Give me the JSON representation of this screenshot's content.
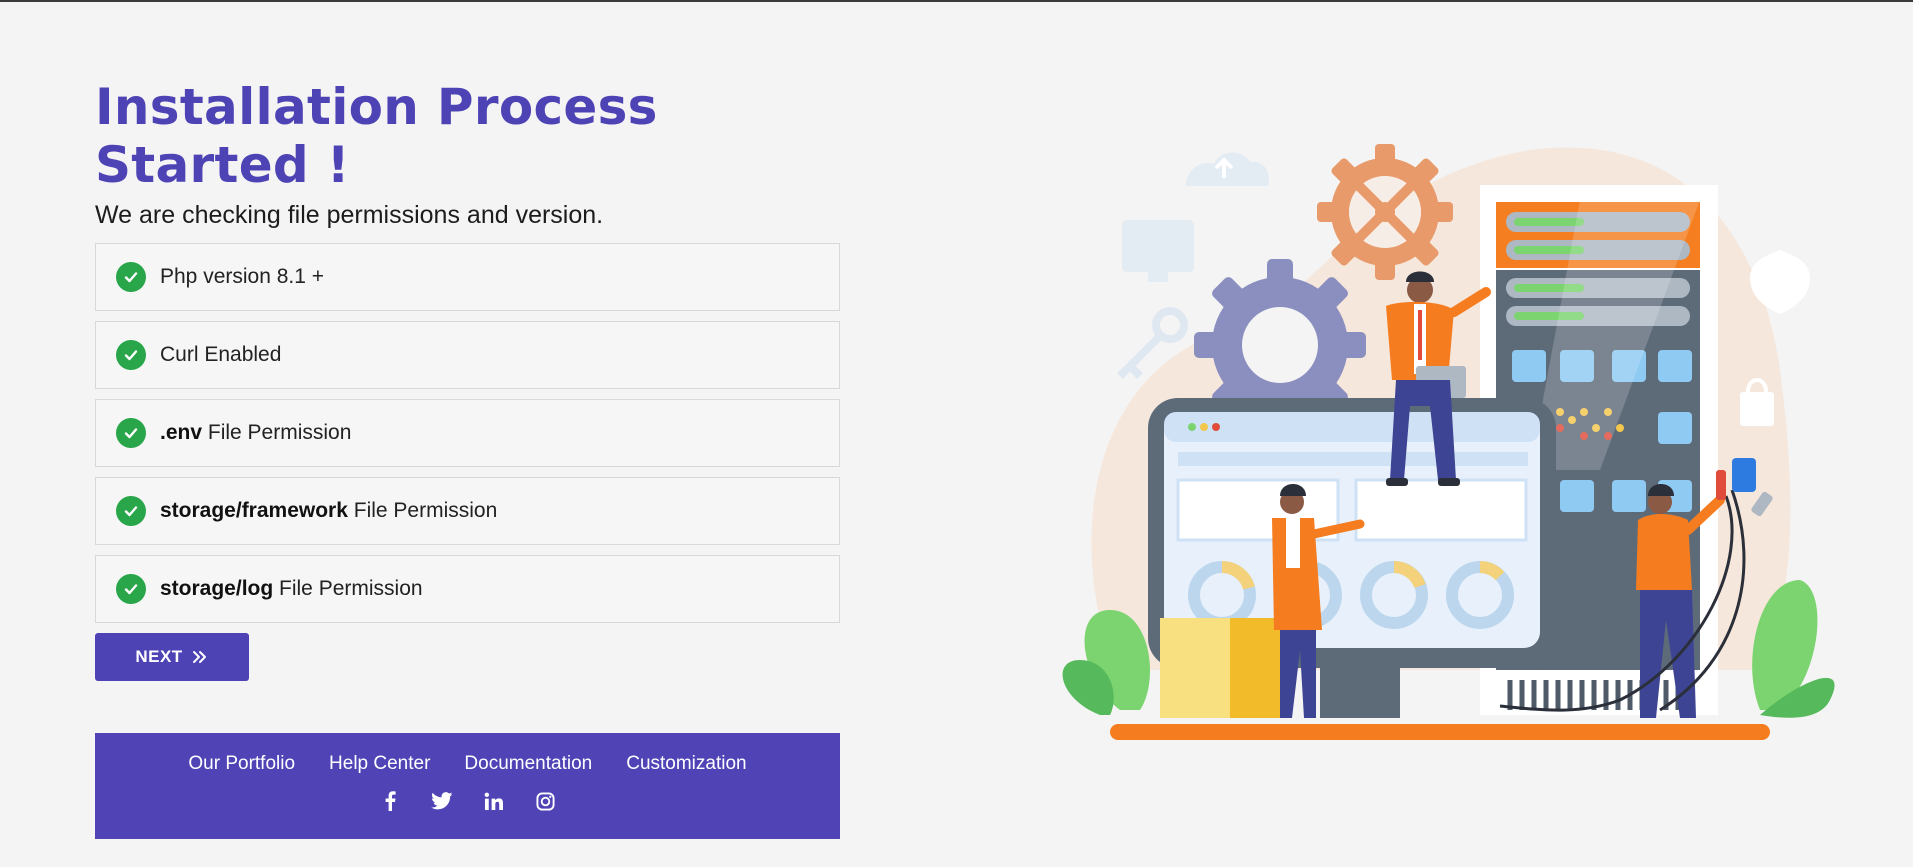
{
  "page": {
    "title": "Installation Process Started !",
    "subtitle": "We are checking file permissions and version."
  },
  "checks": [
    {
      "bold": "",
      "text": "Php version 8.1 +",
      "status_color": "#2aa64a"
    },
    {
      "bold": "",
      "text": "Curl Enabled",
      "status_color": "#2aa64a"
    },
    {
      "bold": ".env",
      "text": " File Permission",
      "status_color": "#2aa64a"
    },
    {
      "bold": "storage/framework",
      "text": " File Permission",
      "status_color": "#2aa64a"
    },
    {
      "bold": "storage/log",
      "text": " File Permission",
      "status_color": "#2aa64a"
    }
  ],
  "next_button": {
    "label": "NEXT",
    "icon": "double-chevron-right-icon"
  },
  "footer": {
    "links": [
      "Our Portfolio",
      "Help Center",
      "Documentation",
      "Customization"
    ],
    "socials": [
      "facebook-icon",
      "twitter-icon",
      "linkedin-icon",
      "instagram-icon"
    ]
  },
  "colors": {
    "accent": "#4e43b5",
    "success": "#2aa64a",
    "background": "#f4f4f4",
    "orange": "#f57c1f"
  }
}
